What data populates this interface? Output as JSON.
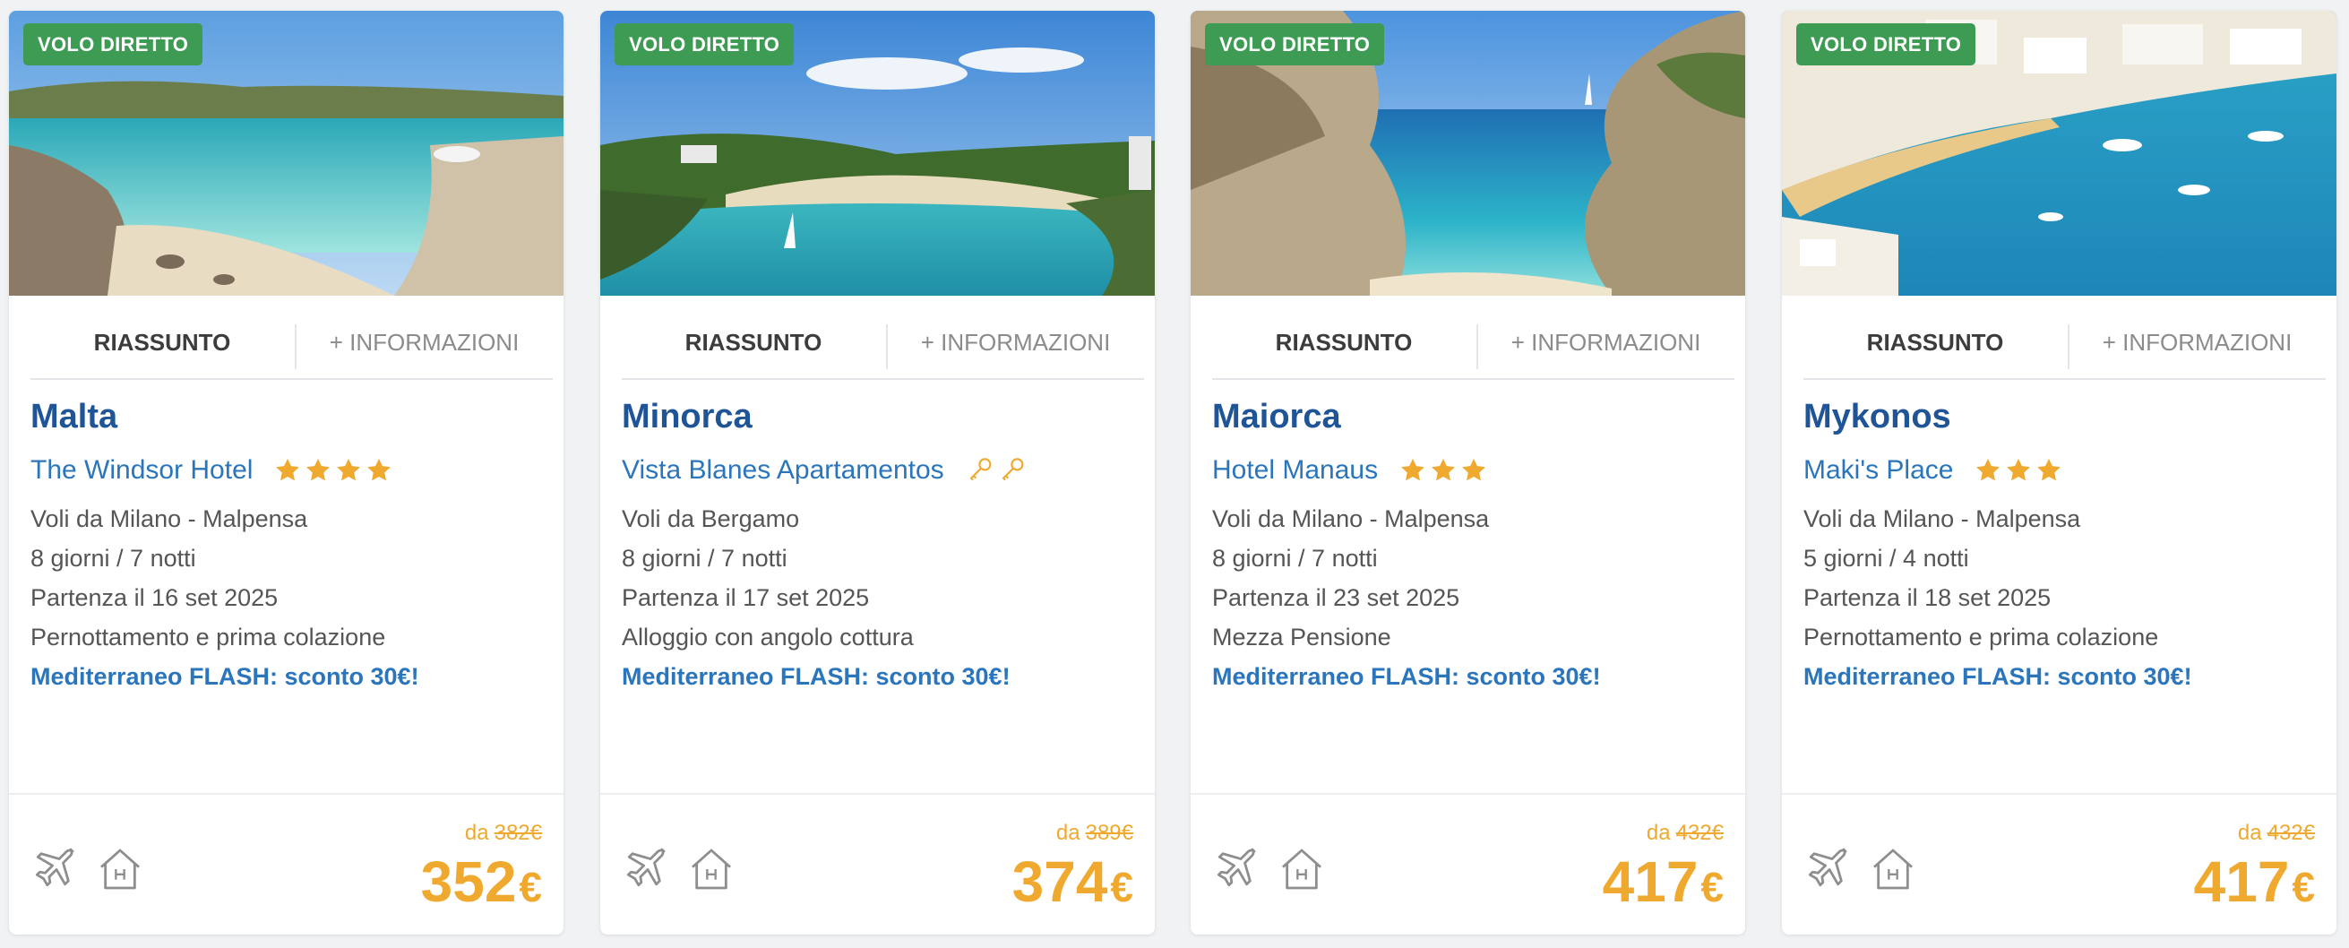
{
  "cards": [
    {
      "badge": "VOLO DIRETTO",
      "tab_summary": "RIASSUNTO",
      "tab_info": "+ INFORMAZIONI",
      "destination": "Malta",
      "hotel": "The Windsor Hotel",
      "rating": {
        "type": "stars",
        "count": 4
      },
      "departure_airport": "Voli da Milano - Malpensa",
      "duration": "8 giorni / 7 notti",
      "departure_date": "Partenza il 16 set 2025",
      "board": "Pernottamento e prima colazione",
      "promo": "Mediterraneo FLASH: sconto 30€!",
      "from_label": "da",
      "old_price": "382€",
      "price": "352",
      "currency": "€",
      "icons": [
        "plane-icon",
        "hotel-icon"
      ]
    },
    {
      "badge": "VOLO DIRETTO",
      "tab_summary": "RIASSUNTO",
      "tab_info": "+ INFORMAZIONI",
      "destination": "Minorca",
      "hotel": "Vista Blanes Apartamentos",
      "rating": {
        "type": "keys",
        "count": 2
      },
      "departure_airport": "Voli da Bergamo",
      "duration": "8 giorni / 7 notti",
      "departure_date": "Partenza il 17 set 2025",
      "board": "Alloggio con angolo cottura",
      "promo": "Mediterraneo FLASH: sconto 30€!",
      "from_label": "da",
      "old_price": "389€",
      "price": "374",
      "currency": "€",
      "icons": [
        "plane-icon",
        "hotel-icon"
      ]
    },
    {
      "badge": "VOLO DIRETTO",
      "tab_summary": "RIASSUNTO",
      "tab_info": "+ INFORMAZIONI",
      "destination": "Maiorca",
      "hotel": "Hotel Manaus",
      "rating": {
        "type": "stars",
        "count": 3
      },
      "departure_airport": "Voli da Milano - Malpensa",
      "duration": "8 giorni / 7 notti",
      "departure_date": "Partenza il 23 set 2025",
      "board": "Mezza Pensione",
      "promo": "Mediterraneo FLASH: sconto 30€!",
      "from_label": "da",
      "old_price": "432€",
      "price": "417",
      "currency": "€",
      "icons": [
        "plane-icon",
        "hotel-icon"
      ]
    },
    {
      "badge": "VOLO DIRETTO",
      "tab_summary": "RIASSUNTO",
      "tab_info": "+ INFORMAZIONI",
      "destination": "Mykonos",
      "hotel": "Maki's Place",
      "rating": {
        "type": "stars",
        "count": 3
      },
      "departure_airport": "Voli da Milano - Malpensa",
      "duration": "5 giorni / 4 notti",
      "departure_date": "Partenza il 18 set 2025",
      "board": "Pernottamento e prima colazione",
      "promo": "Mediterraneo FLASH: sconto 30€!",
      "from_label": "da",
      "old_price": "432€",
      "price": "417",
      "currency": "€",
      "icons": [
        "plane-icon",
        "hotel-icon"
      ]
    }
  ],
  "colors": {
    "badge": "#3e9b53",
    "destination": "#1f5597",
    "hotel": "#2a75bb",
    "price": "#f0a92f",
    "star": "#f0a92f"
  }
}
